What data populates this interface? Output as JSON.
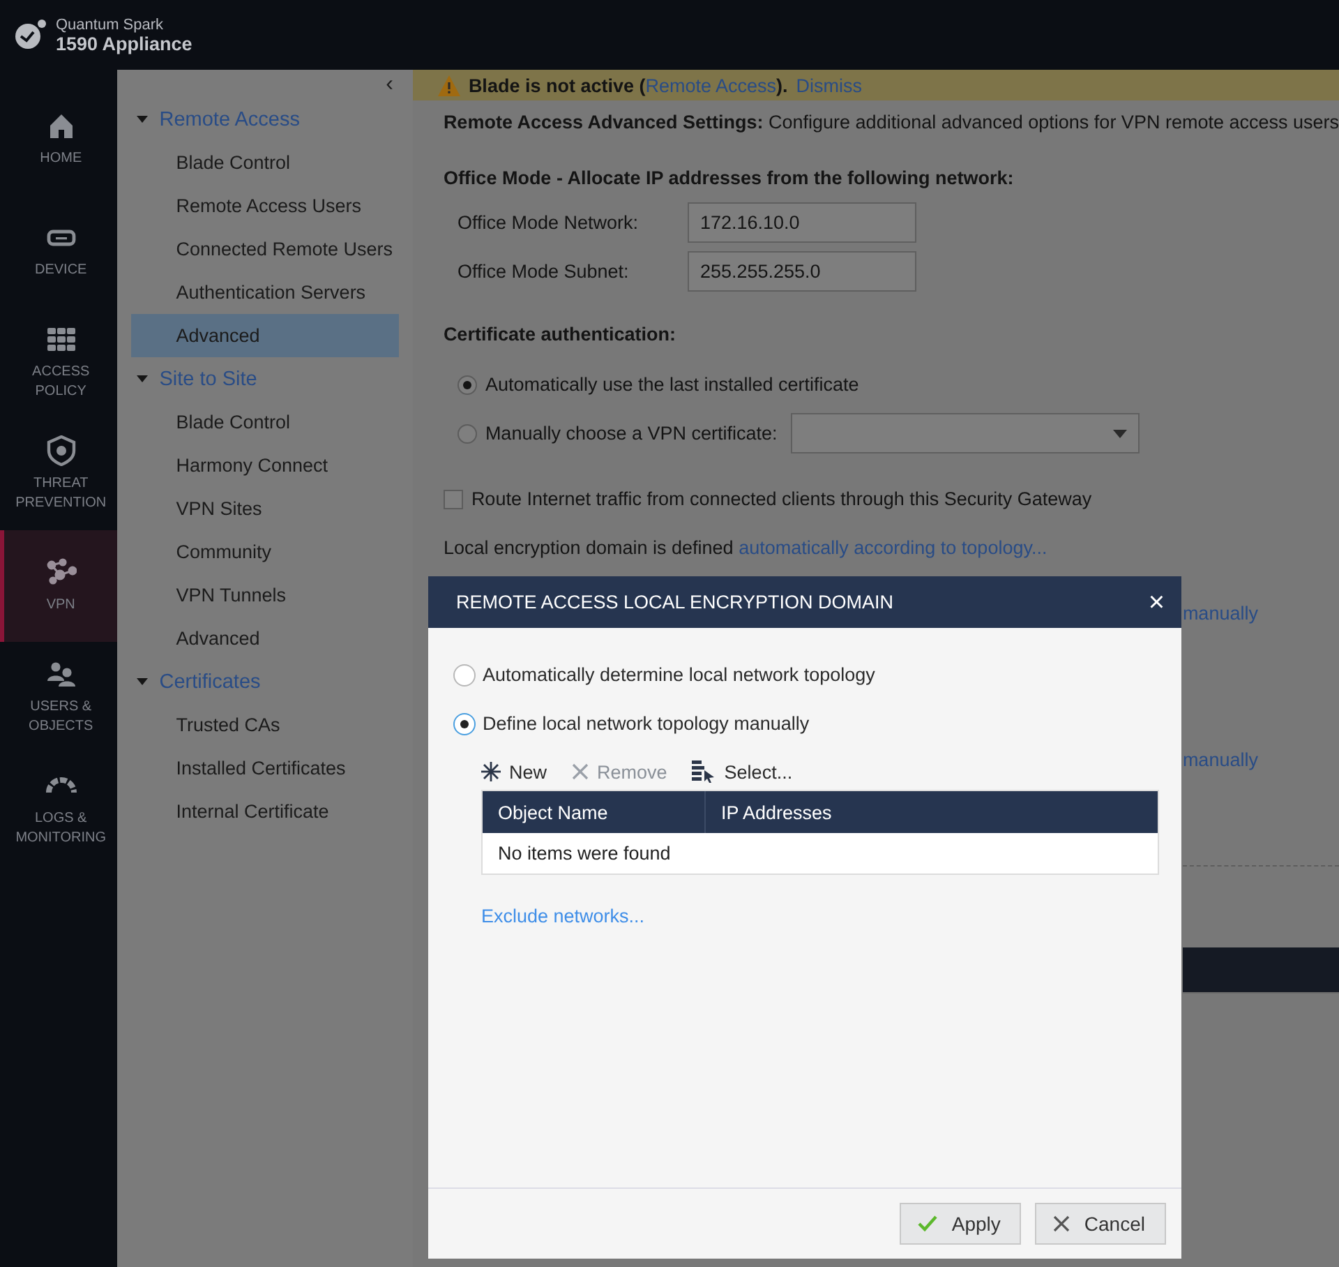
{
  "header": {
    "brand": "Quantum Spark",
    "model": "1590 Appliance"
  },
  "nav": [
    {
      "label": "HOME",
      "kind": "home",
      "selected": false
    },
    {
      "label": "DEVICE",
      "kind": "device",
      "selected": false
    },
    {
      "label": "ACCESS POLICY",
      "kind": "grid",
      "selected": false
    },
    {
      "label": "THREAT PREVENTION",
      "kind": "shield",
      "selected": false
    },
    {
      "label": "VPN",
      "kind": "vpn",
      "selected": true
    },
    {
      "label": "USERS & OBJECTS",
      "kind": "users",
      "selected": false
    },
    {
      "label": "LOGS & MONITORING",
      "kind": "gauge",
      "selected": false
    }
  ],
  "submenu": {
    "collapse": "‹",
    "groups": [
      {
        "label": "Remote Access",
        "expanded": true,
        "children": [
          {
            "label": "Blade Control",
            "selected": false
          },
          {
            "label": "Remote Access Users",
            "selected": false
          },
          {
            "label": "Connected Remote Users",
            "selected": false
          },
          {
            "label": "Authentication Servers",
            "selected": false
          },
          {
            "label": "Advanced",
            "selected": true
          }
        ]
      },
      {
        "label": "Site to Site",
        "expanded": true,
        "children": [
          {
            "label": "Blade Control",
            "selected": false
          },
          {
            "label": "Harmony Connect",
            "selected": false
          },
          {
            "label": "VPN Sites",
            "selected": false
          },
          {
            "label": "Community",
            "selected": false
          },
          {
            "label": "VPN Tunnels",
            "selected": false
          },
          {
            "label": "Advanced",
            "selected": false
          }
        ]
      },
      {
        "label": "Certificates",
        "expanded": true,
        "children": [
          {
            "label": "Trusted CAs",
            "selected": false
          },
          {
            "label": "Installed Certificates",
            "selected": false
          },
          {
            "label": "Internal Certificate",
            "selected": false
          }
        ]
      }
    ]
  },
  "banner": {
    "text_before": "Blade is not active (",
    "link": "Remote Access",
    "text_after": ").",
    "dismiss": "Dismiss"
  },
  "description": "**Remote Access Advanced Settings:** Configure additional advanced options for VPN remote access users",
  "office_mode": {
    "heading": "Office Mode - Allocate IP addresses from the following network:",
    "fields": [
      {
        "label": "Office Mode Network:",
        "value": "172.16.10.0"
      },
      {
        "label": "Office Mode Subnet:",
        "value": "255.255.255.0"
      }
    ]
  },
  "certificate": {
    "heading": "Certificate authentication:",
    "options": [
      {
        "label": "Automatically use the last installed certificate",
        "selected": true,
        "kind": "plain"
      },
      {
        "label": "Manually choose a VPN certificate:",
        "selected": false,
        "kind": "dropdown"
      }
    ]
  },
  "route_internet": {
    "label": "Route Internet traffic from connected clients through this Security Gateway",
    "checked": false
  },
  "encryption_domain": {
    "text": "Local encryption domain is defined",
    "link": "automatically according to topology..."
  },
  "behind_links": [
    "manually",
    "manually"
  ],
  "dialog": {
    "title": "REMOTE ACCESS LOCAL ENCRYPTION DOMAIN",
    "close": "×",
    "options": [
      {
        "label": "Automatically determine local network topology",
        "selected": false
      },
      {
        "label": "Define local network topology manually",
        "selected": true
      }
    ],
    "toolbar": [
      {
        "label": "New",
        "kind": "new",
        "disabled": false
      },
      {
        "label": "Remove",
        "kind": "remove",
        "disabled": true
      },
      {
        "label": "Select...",
        "kind": "select",
        "disabled": false
      }
    ],
    "table": {
      "columns": [
        "Object Name",
        "IP Addresses"
      ],
      "empty": "No items were found"
    },
    "exclude_link": "Exclude networks...",
    "buttons": [
      {
        "label": "Apply",
        "kind": "apply"
      },
      {
        "label": "Cancel",
        "kind": "cancel"
      }
    ]
  }
}
